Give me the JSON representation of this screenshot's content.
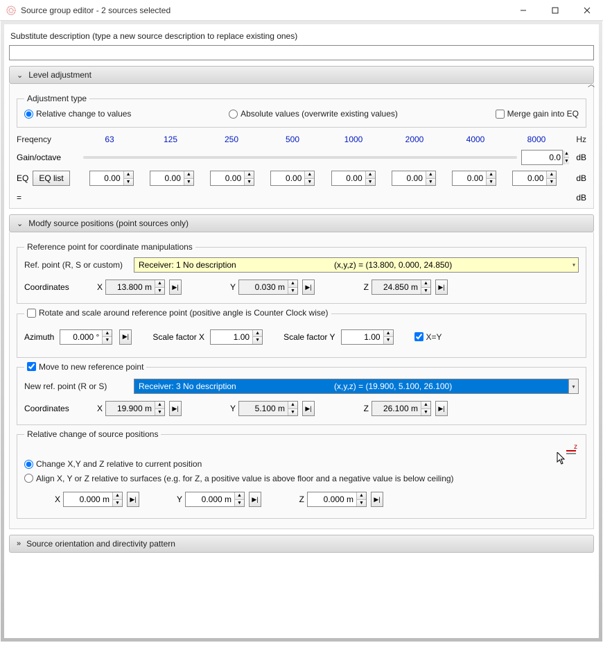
{
  "window": {
    "title": "Source group editor - 2 sources selected"
  },
  "substitute": {
    "label": "Substitute description (type a new source description to replace existing ones)",
    "value": ""
  },
  "level": {
    "header": "Level adjustment",
    "adj_legend": "Adjustment type",
    "radio_relative": "Relative change to values",
    "radio_absolute": "Absolute values (overwrite existing values)",
    "merge_eq": "Merge gain into EQ",
    "freq_label": "Freqency",
    "freqs": [
      "63",
      "125",
      "250",
      "500",
      "1000",
      "2000",
      "4000",
      "8000"
    ],
    "hz": "Hz",
    "gain_label": "Gain/octave",
    "gain_value": "0.0",
    "eq_label": "EQ",
    "eq_list_btn": "EQ list",
    "eq_values": [
      "0.00",
      "0.00",
      "0.00",
      "0.00",
      "0.00",
      "0.00",
      "0.00",
      "0.00"
    ],
    "db": "dB",
    "equals": "="
  },
  "modify": {
    "header": "Modfy source positions (point sources only)",
    "ref_legend": "Reference point for coordinate manipulations",
    "ref_label": "Ref. point (R, S or custom)",
    "ref_dd_text": "Receiver: 1 No description",
    "ref_dd_coords": "(x,y,z) = (13.800, 0.000, 24.850)",
    "coords_label": "Coordinates",
    "ref_x": "13.800 m",
    "ref_y": "0.030 m",
    "ref_z": "24.850 m",
    "rotate_legend": "Rotate and scale around reference point (positive angle is Counter Clock wise)",
    "azimuth_label": "Azimuth",
    "azimuth": "0.000 °",
    "sfx_label": "Scale factor X",
    "sfx": "1.00",
    "sfy_label": "Scale factor Y",
    "sfy": "1.00",
    "xy_label": "X=Y",
    "move_legend": "Move to new reference point",
    "new_ref_label": "New ref. point (R or S)",
    "new_dd_text": "Receiver: 3 No description",
    "new_dd_coords": "(x,y,z) = (19.900, 5.100, 26.100)",
    "new_x": "19.900 m",
    "new_y": "5.100 m",
    "new_z": "26.100 m",
    "rel_legend": "Relative change of source positions",
    "change_radio": "Change X,Y and Z relative to current position",
    "align_radio": "Align X, Y or Z relative to surfaces (e.g. for Z, a positive value is above floor and a negative value is below ceiling)",
    "rel_x": "0.000 m",
    "rel_y": "0.000 m",
    "rel_z": "0.000 m"
  },
  "orient": {
    "header": "Source orientation and directivity pattern"
  },
  "axes": {
    "x": "X",
    "y": "Y",
    "z": "Z"
  }
}
